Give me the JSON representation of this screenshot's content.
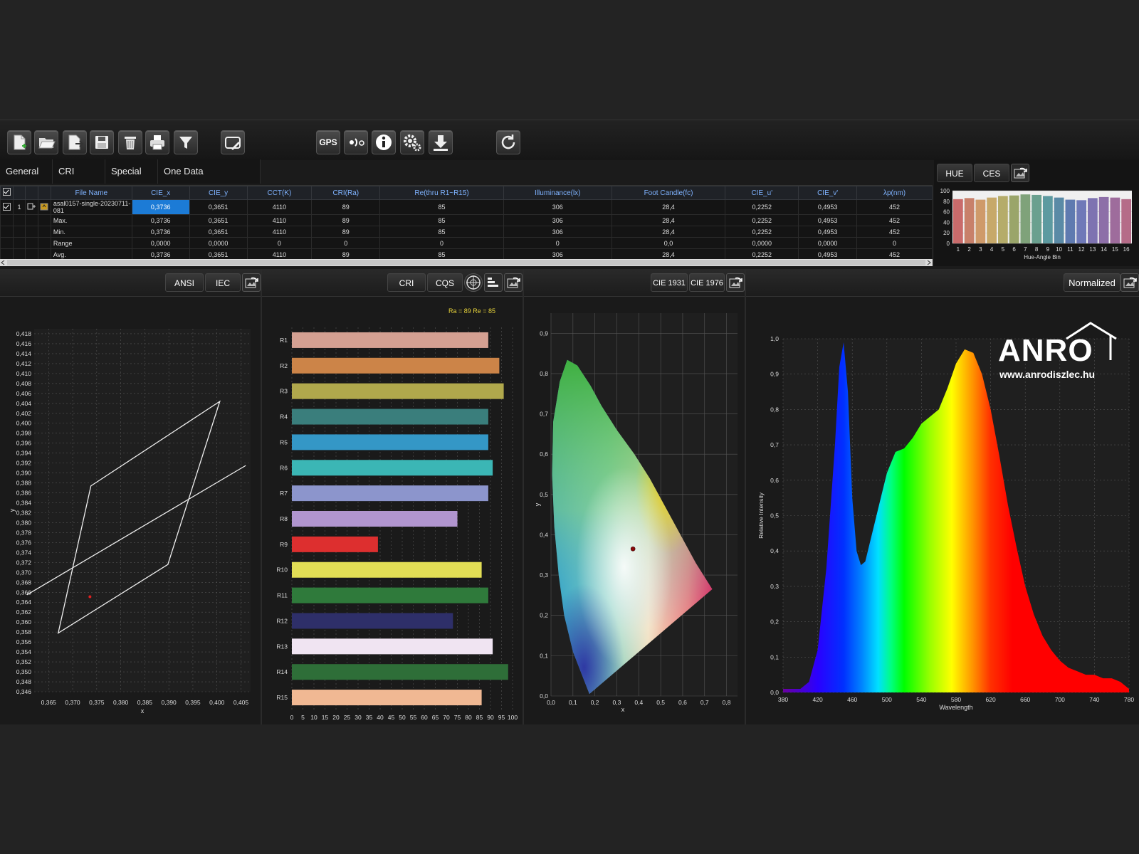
{
  "toolbar": {
    "gps_label": "GPS",
    "buttons": [
      "new-file-icon",
      "open-folder-icon",
      "export-file-icon",
      "save-icon",
      "delete-icon",
      "print-icon",
      "filter-icon",
      "edit-report-icon",
      "gps-icon",
      "wireless-icon",
      "info-icon",
      "settings-icon",
      "download-icon",
      "refresh-icon"
    ]
  },
  "tabs": [
    "General",
    "CRI",
    "Special",
    "One Data"
  ],
  "table": {
    "columns": [
      "File Name",
      "CIE_x",
      "CIE_y",
      "CCT(K)",
      "CRI(Ra)",
      "Re(thru R1~R15)",
      "Illuminance(lx)",
      "Foot Candle(fc)",
      "CIE_u'",
      "CIE_v'",
      "λp(nm)"
    ],
    "rows": [
      {
        "index": "1",
        "name": "asal0157-single-20230711-081",
        "values": [
          "0,3736",
          "0,3651",
          "4110",
          "89",
          "85",
          "306",
          "28,4",
          "0,2252",
          "0,4953",
          "452"
        ]
      },
      {
        "index": "",
        "name": "Max.",
        "values": [
          "0,3736",
          "0,3651",
          "4110",
          "89",
          "85",
          "306",
          "28,4",
          "0,2252",
          "0,4953",
          "452"
        ]
      },
      {
        "index": "",
        "name": "Min.",
        "values": [
          "0,3736",
          "0,3651",
          "4110",
          "89",
          "85",
          "306",
          "28,4",
          "0,2252",
          "0,4953",
          "452"
        ]
      },
      {
        "index": "",
        "name": "Range",
        "values": [
          "0,0000",
          "0,0000",
          "0",
          "0",
          "0",
          "0",
          "0,0",
          "0,0000",
          "0,0000",
          "0"
        ]
      },
      {
        "index": "",
        "name": "Avg.",
        "values": [
          "0,3736",
          "0,3651",
          "4110",
          "89",
          "85",
          "306",
          "28,4",
          "0,2252",
          "0,4953",
          "452"
        ]
      }
    ]
  },
  "hue_panel": {
    "buttons": [
      "HUE",
      "CES"
    ],
    "xlabel": "Hue-Angle Bin"
  },
  "panels": {
    "ansi": {
      "buttons": [
        "ANSI",
        "IEC"
      ]
    },
    "cri": {
      "buttons": [
        "CRI",
        "CQS"
      ],
      "summary": "Ra = 89   Re = 85"
    },
    "cie": {
      "buttons": [
        "CIE 1931",
        "CIE 1976"
      ]
    },
    "spectrum": {
      "button": "Normalized"
    }
  },
  "watermark": {
    "brand": "ANRO",
    "url": "www.anrodiszlec.hu"
  },
  "chart_data": [
    {
      "type": "bar",
      "name_id": "hue-angle-bins",
      "categories": [
        "1",
        "2",
        "3",
        "4",
        "5",
        "6",
        "7",
        "8",
        "9",
        "10",
        "11",
        "12",
        "13",
        "14",
        "15",
        "16"
      ],
      "values": [
        84,
        86,
        83,
        87,
        90,
        91,
        93,
        92,
        90,
        87,
        83,
        82,
        86,
        88,
        87,
        84
      ],
      "colors": [
        "#c96b6b",
        "#c8806a",
        "#cf9a6a",
        "#c7a96a",
        "#b5ac6a",
        "#9aa56a",
        "#7fa27a",
        "#6aa08f",
        "#5d9aa0",
        "#5a8aa6",
        "#5f7ab0",
        "#6f79b8",
        "#7e73b1",
        "#8d6fa8",
        "#9e6c9c",
        "#b56c88"
      ],
      "ylim": [
        0,
        100
      ],
      "yticks": [
        0,
        20,
        40,
        60,
        80,
        100
      ],
      "xlabel": "Hue-Angle Bin"
    },
    {
      "type": "scatter",
      "name_id": "ansi-chromaticity",
      "x_ticks": [
        "0,365",
        "0,370",
        "0,375",
        "0,380",
        "0,385",
        "0,390",
        "0,395",
        "0,400",
        "0,405"
      ],
      "y_ticks": [
        "0,346",
        "0,348",
        "0,350",
        "0,352",
        "0,354",
        "0,356",
        "0,358",
        "0,360",
        "0,362",
        "0,364",
        "0,366",
        "0,368",
        "0,370",
        "0,372",
        "0,374",
        "0,376",
        "0,378",
        "0,380",
        "0,382",
        "0,384",
        "0,386",
        "0,388",
        "0,390",
        "0,392",
        "0,394",
        "0,396",
        "0,398",
        "0,400",
        "0,402",
        "0,404",
        "0,406",
        "0,408",
        "0,410",
        "0,412",
        "0,414",
        "0,416",
        "0,418"
      ],
      "xlim": [
        0.362,
        0.407
      ],
      "ylim": [
        0.346,
        0.419
      ],
      "xlabel": "x",
      "ylabel": "y",
      "quadrangle": [
        [
          0.3738,
          0.3874
        ],
        [
          0.4006,
          0.4044
        ],
        [
          0.3898,
          0.3716
        ],
        [
          0.367,
          0.3578
        ]
      ],
      "blackbody_line": [
        [
          0.3605,
          0.3655
        ],
        [
          0.406,
          0.3915
        ]
      ],
      "point": {
        "x": 0.3736,
        "y": 0.3651
      }
    },
    {
      "type": "bar",
      "name_id": "cri-r-values",
      "categories": [
        "R1",
        "R2",
        "R3",
        "R4",
        "R5",
        "R6",
        "R7",
        "R8",
        "R9",
        "R10",
        "R11",
        "R12",
        "R13",
        "R14",
        "R15"
      ],
      "values": [
        89,
        94,
        96,
        89,
        89,
        91,
        89,
        75,
        39,
        86,
        89,
        73,
        91,
        98,
        86
      ],
      "colors": [
        "#d4a092",
        "#cc8448",
        "#b0a84c",
        "#3a7e7c",
        "#3497c6",
        "#3bb6b5",
        "#8c95cc",
        "#b195cf",
        "#dd2f2f",
        "#e2de55",
        "#2f7a3b",
        "#2e2f69",
        "#f0e4f2",
        "#2e6e38",
        "#f0b893"
      ],
      "xlim": [
        0,
        100
      ],
      "xticks": [
        "0",
        "5",
        "10",
        "15",
        "20",
        "25",
        "30",
        "35",
        "40",
        "45",
        "50",
        "55",
        "60",
        "65",
        "70",
        "75",
        "80",
        "85",
        "90",
        "95",
        "100"
      ]
    },
    {
      "type": "scatter",
      "name_id": "cie-1931-diagram",
      "x_ticks": [
        "0,0",
        "0,1",
        "0,2",
        "0,3",
        "0,4",
        "0,5",
        "0,6",
        "0,7",
        "0,8"
      ],
      "y_ticks": [
        "0,0",
        "0,1",
        "0,2",
        "0,3",
        "0,4",
        "0,5",
        "0,6",
        "0,7",
        "0,8",
        "0,9"
      ],
      "xlim": [
        0,
        0.85
      ],
      "ylim": [
        0,
        0.95
      ],
      "xlabel": "x",
      "ylabel": "y",
      "point": {
        "x": 0.3736,
        "y": 0.3651
      }
    },
    {
      "type": "area",
      "name_id": "relative-spectrum",
      "x_ticks": [
        "380",
        "420",
        "460",
        "500",
        "540",
        "580",
        "620",
        "660",
        "700",
        "740",
        "780"
      ],
      "y_ticks": [
        "0,0",
        "0,1",
        "0,2",
        "0,3",
        "0,4",
        "0,5",
        "0,6",
        "0,7",
        "0,8",
        "0,9",
        "1,0"
      ],
      "xlim": [
        380,
        780
      ],
      "ylim": [
        0,
        1
      ],
      "xlabel": "Wavelength",
      "ylabel": "Relative Intensity",
      "x": [
        380,
        400,
        410,
        420,
        430,
        440,
        445,
        450,
        455,
        460,
        465,
        470,
        475,
        480,
        490,
        500,
        510,
        520,
        530,
        540,
        550,
        560,
        570,
        580,
        590,
        600,
        610,
        620,
        630,
        640,
        650,
        660,
        670,
        680,
        690,
        700,
        710,
        720,
        730,
        740,
        750,
        760,
        770,
        780
      ],
      "y": [
        0.01,
        0.01,
        0.03,
        0.12,
        0.35,
        0.7,
        0.92,
        0.99,
        0.85,
        0.55,
        0.4,
        0.36,
        0.37,
        0.42,
        0.52,
        0.62,
        0.68,
        0.69,
        0.72,
        0.76,
        0.78,
        0.8,
        0.86,
        0.93,
        0.97,
        0.96,
        0.9,
        0.8,
        0.67,
        0.53,
        0.41,
        0.3,
        0.22,
        0.16,
        0.12,
        0.09,
        0.07,
        0.06,
        0.05,
        0.05,
        0.04,
        0.04,
        0.03,
        0.01
      ],
      "peak_nm": "452"
    }
  ]
}
